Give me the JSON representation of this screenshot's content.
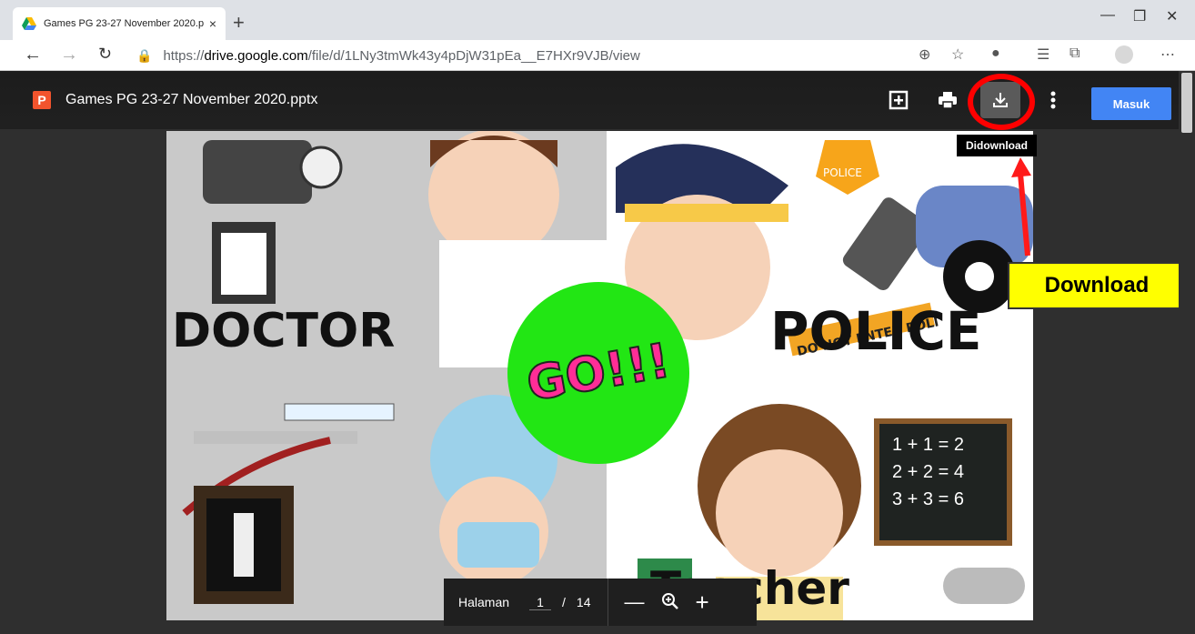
{
  "browser": {
    "tab_title": "Games PG 23-27 November 2020.p",
    "tab_close": "×",
    "new_tab": "+",
    "url_prefix": "https://",
    "url_domain": "drive.google.com",
    "url_path": "/file/d/1LNy3tmWk43y4pDjW31pEa__E7HXr9VJB/view"
  },
  "viewer": {
    "doc_icon_letter": "P",
    "doc_title": "Games PG 23-27 November 2020.pptx",
    "signin_label": "Masuk",
    "tooltip": "Didownload",
    "callout": "Download"
  },
  "slide": {
    "doctor": "DOCTOR",
    "police": "POLICE",
    "go": "GO!!!",
    "teacher": "Teacher",
    "police_badge": "POLICE",
    "tape": "DO NOT ENTER POLI",
    "board": [
      "1 + 1 = 2",
      "2 + 2 = 4",
      "3 + 3 = 6"
    ]
  },
  "pager": {
    "label": "Halaman",
    "current": "1",
    "slash": "/",
    "total": "14"
  },
  "colors": {
    "download_button": "#5a5a5a",
    "signin_button": "#4285f4",
    "highlight": "#ff0000",
    "callout_bg": "#ffff00",
    "go_circle": "#22e614"
  }
}
